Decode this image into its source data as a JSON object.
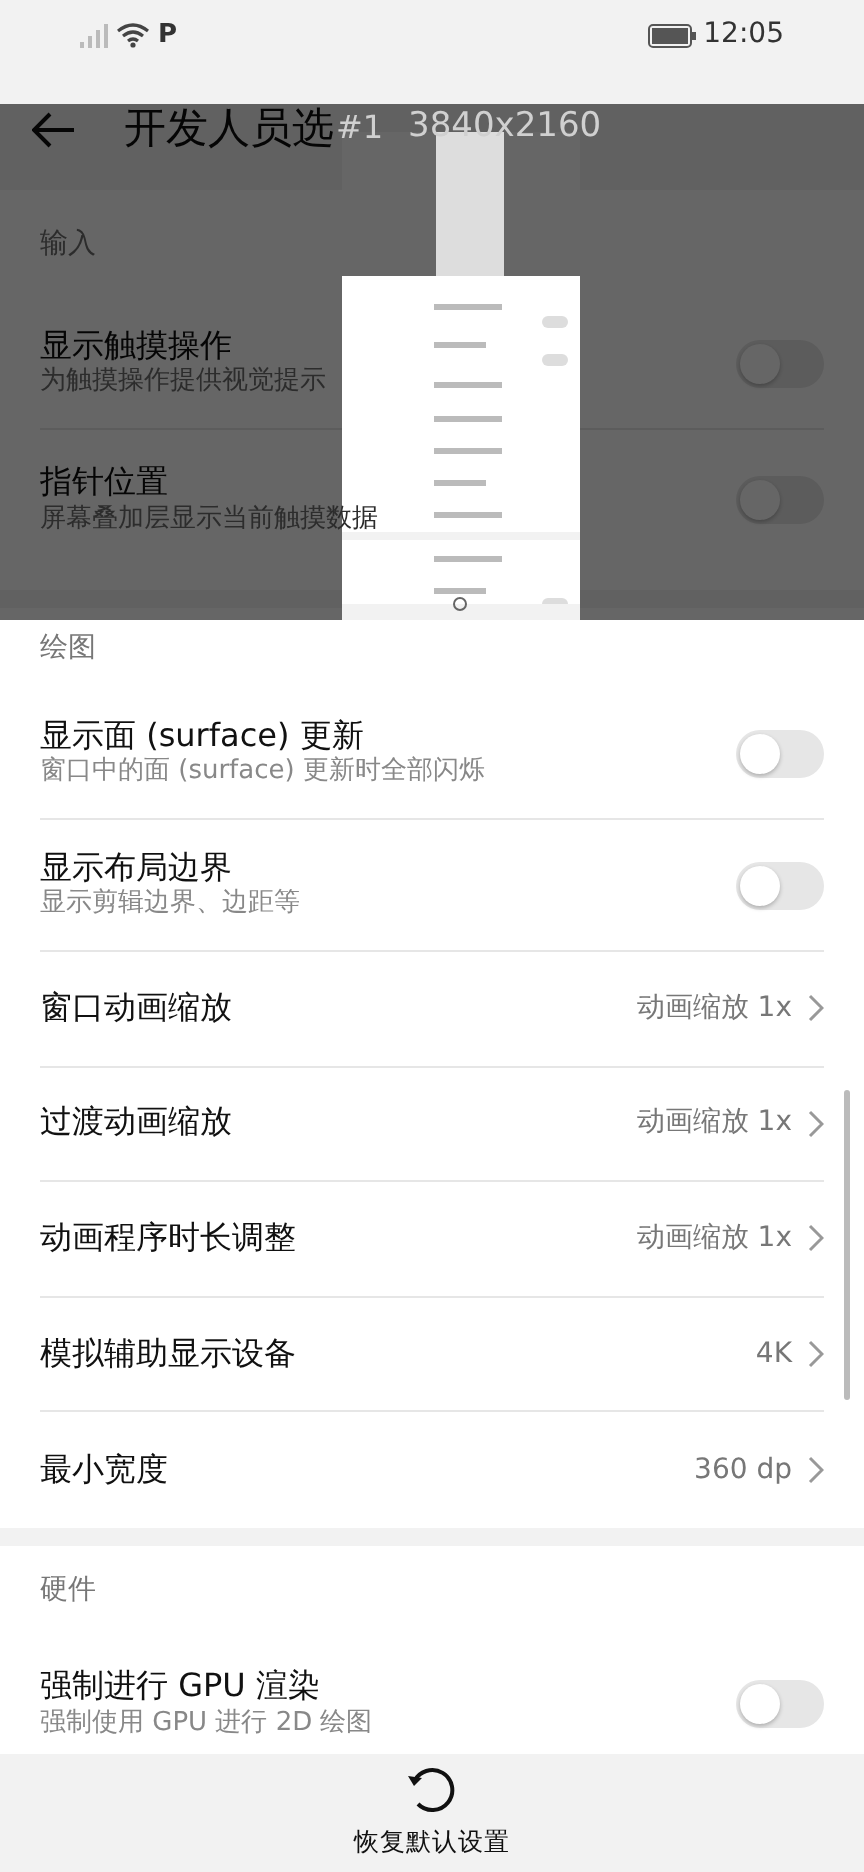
{
  "status_bar": {
    "notification": "P",
    "time": "12:05"
  },
  "header": {
    "title": "开发人员选"
  },
  "sections": [
    {
      "title": "输入",
      "items": [
        {
          "kind": "switch",
          "title": "显示触摸操作",
          "subtitle": "为触摸操作提供视觉提示",
          "on": false
        },
        {
          "kind": "switch",
          "title": "指针位置",
          "subtitle": "屏幕叠加层显示当前触摸数据",
          "on": false
        }
      ]
    },
    {
      "title": "绘图",
      "items": [
        {
          "kind": "switch",
          "title": "显示面 (surface) 更新",
          "subtitle": "窗口中的面 (surface) 更新时全部闪烁",
          "on": false
        },
        {
          "kind": "switch",
          "title": "显示布局边界",
          "subtitle": "显示剪辑边界、边距等",
          "on": false
        },
        {
          "kind": "value",
          "title": "窗口动画缩放",
          "value": "动画缩放 1x"
        },
        {
          "kind": "value",
          "title": "过渡动画缩放",
          "value": "动画缩放 1x"
        },
        {
          "kind": "value",
          "title": "动画程序时长调整",
          "value": "动画缩放 1x"
        },
        {
          "kind": "value",
          "title": "模拟辅助显示设备",
          "value": "4K"
        },
        {
          "kind": "value",
          "title": "最小宽度",
          "value": "360 dp"
        }
      ]
    },
    {
      "title": "硬件",
      "items": [
        {
          "kind": "switch",
          "title": "强制进行 GPU 渲染",
          "subtitle": "强制使用 GPU 进行 2D 绘图",
          "on": false
        }
      ]
    }
  ],
  "overlay": {
    "index": "#1",
    "resolution": "3840x2160"
  },
  "footer": {
    "label": "恢复默认设置"
  }
}
